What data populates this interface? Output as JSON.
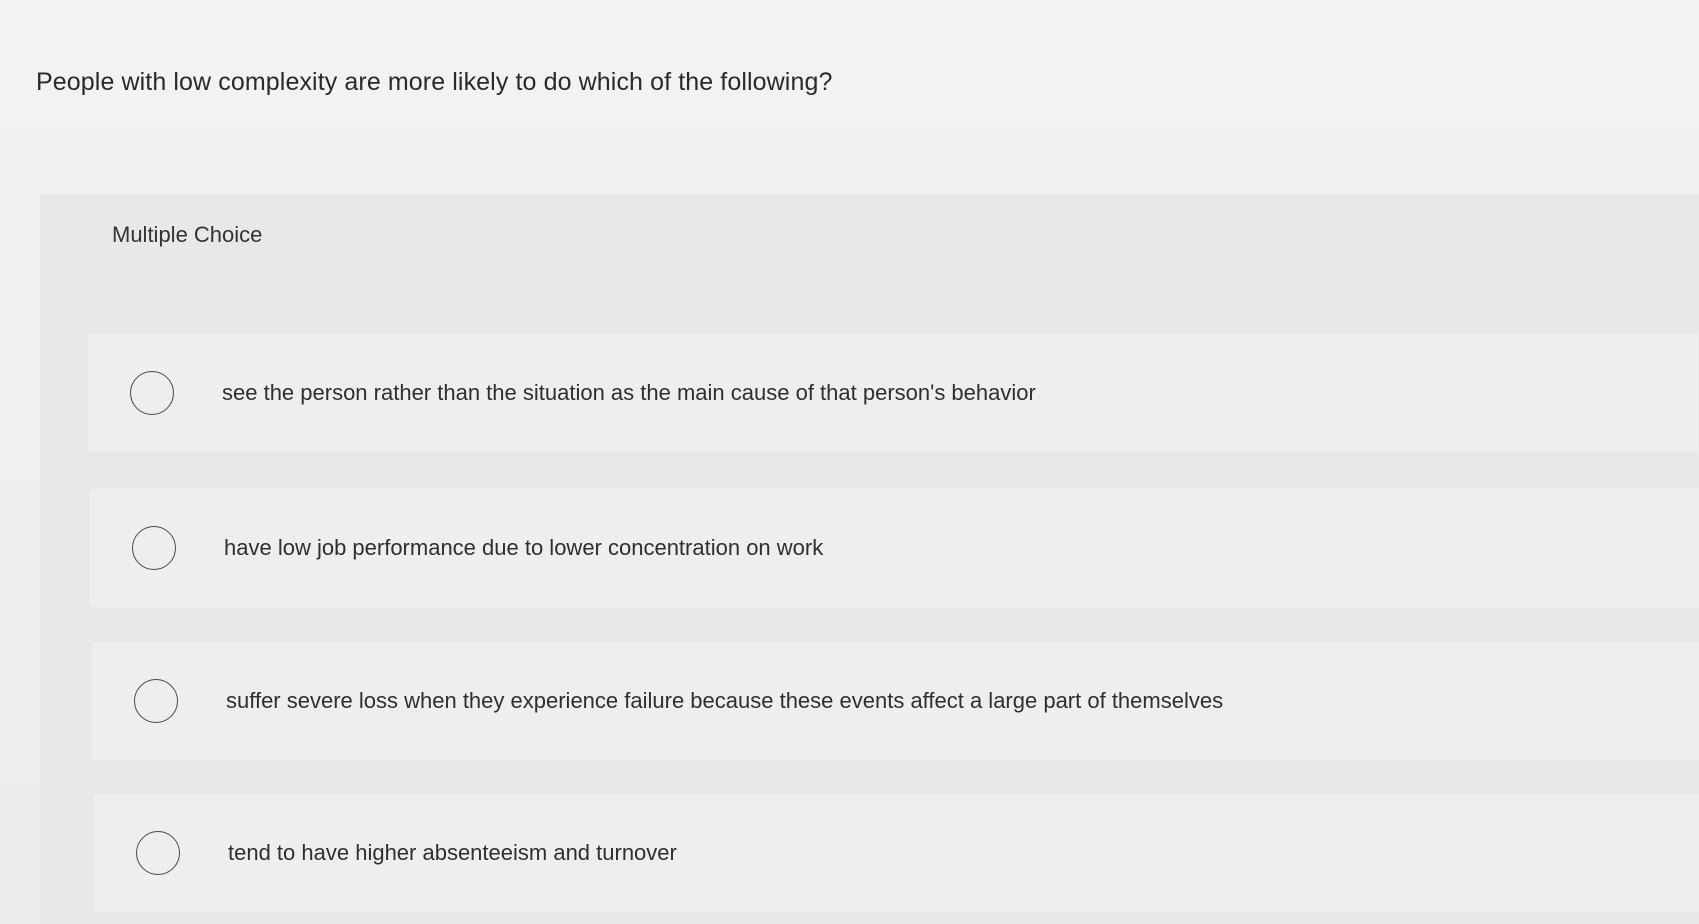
{
  "question": {
    "text": "People with low complexity are more likely to do which of the following?"
  },
  "multiple_choice": {
    "label": "Multiple Choice",
    "options": [
      {
        "text": "see the person rather than the situation as the main cause of that person's behavior",
        "selected": false
      },
      {
        "text": "have low job performance due to lower concentration on work",
        "selected": false
      },
      {
        "text": "suffer severe loss when they experience failure because these events affect a large part of themselves",
        "selected": false
      },
      {
        "text": "tend to have higher absenteeism and turnover",
        "selected": false
      }
    ]
  }
}
